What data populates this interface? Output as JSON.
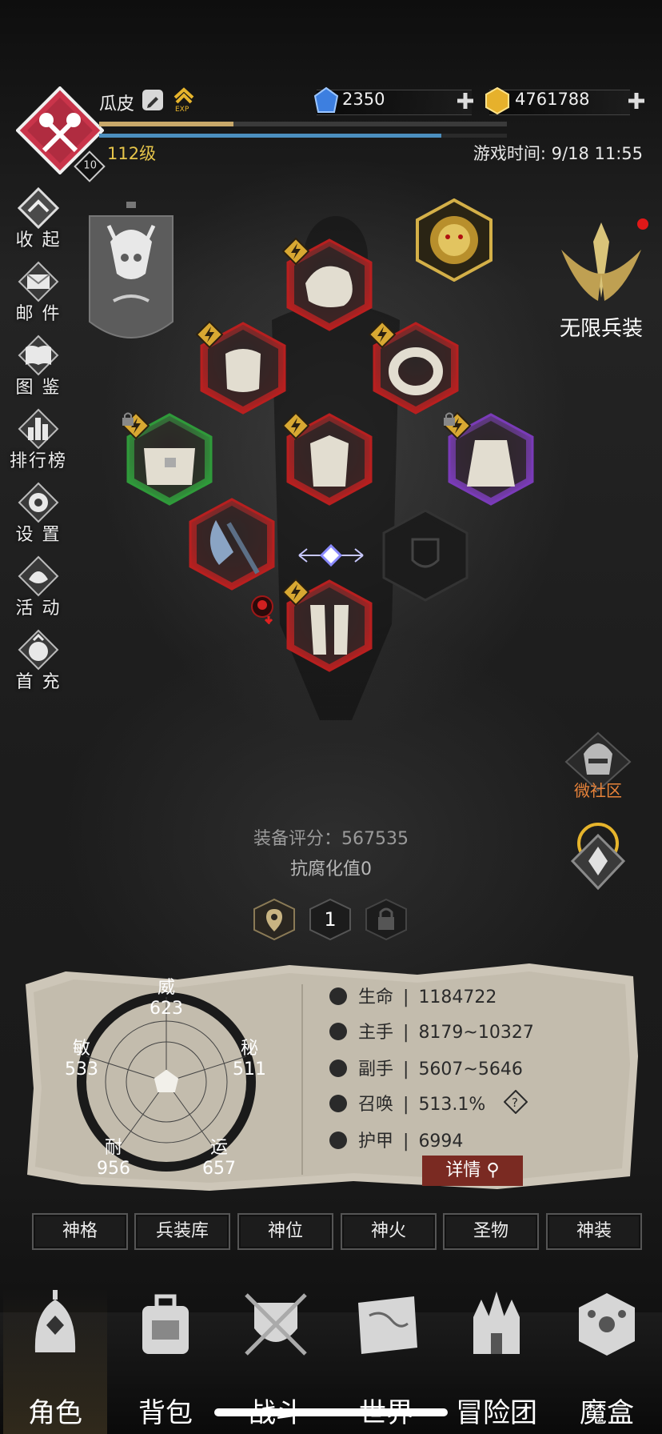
{
  "player": {
    "name": "瓜皮",
    "level_text": "112级",
    "level_badge": "10",
    "exp_label": "EXP",
    "exp_progress": 0.33,
    "hp_progress": 0.84,
    "game_time": "游戏时间: 9/18 11:55"
  },
  "currency": {
    "gems": "2350",
    "gold": "4761788"
  },
  "left_menu": [
    {
      "label": "收 起",
      "icon": "collapse-icon"
    },
    {
      "label": "邮 件",
      "icon": "mail-icon"
    },
    {
      "label": "图 鉴",
      "icon": "codex-icon"
    },
    {
      "label": "排行榜",
      "icon": "ranking-icon"
    },
    {
      "label": "设 置",
      "icon": "gear-icon"
    },
    {
      "label": "活 动",
      "icon": "event-icon"
    },
    {
      "label": "首 充",
      "icon": "first-recharge-icon"
    }
  ],
  "infinite_weapon": {
    "label": "无限兵装"
  },
  "community": {
    "label": "微社区"
  },
  "equipment": {
    "score_text": "装备评分：567535",
    "corruption_text": "抗腐化值0"
  },
  "loadouts": {
    "current": "1"
  },
  "radar": {
    "wei": {
      "label": "威",
      "value": "623"
    },
    "mi": {
      "label": "秘",
      "value": "511"
    },
    "yun": {
      "label": "运",
      "value": "657"
    },
    "nai": {
      "label": "耐",
      "value": "956"
    },
    "min": {
      "label": "敏",
      "value": "533"
    }
  },
  "stats": [
    {
      "label": "生命",
      "value": "1184722",
      "icon": "heart-icon"
    },
    {
      "label": "主手",
      "value": "8179~10327",
      "icon": "main-hand-icon"
    },
    {
      "label": "副手",
      "value": "5607~5646",
      "icon": "off-hand-icon"
    },
    {
      "label": "召唤",
      "value": "513.1%",
      "icon": "summon-icon"
    },
    {
      "label": "护甲",
      "value": "6994",
      "icon": "armor-icon"
    }
  ],
  "detail_button": "详情",
  "tabs": [
    "神格",
    "兵装库",
    "神位",
    "神火",
    "圣物",
    "神装"
  ],
  "nav": [
    "角色",
    "背包",
    "战斗",
    "世界",
    "冒险团",
    "魔盒"
  ],
  "colors": {
    "gold": "#e6c54a",
    "red_frame": "#b81f1f",
    "green_frame": "#2f9a3a",
    "purple_frame": "#7a3bb8",
    "detail_button": "#7a2a22"
  }
}
